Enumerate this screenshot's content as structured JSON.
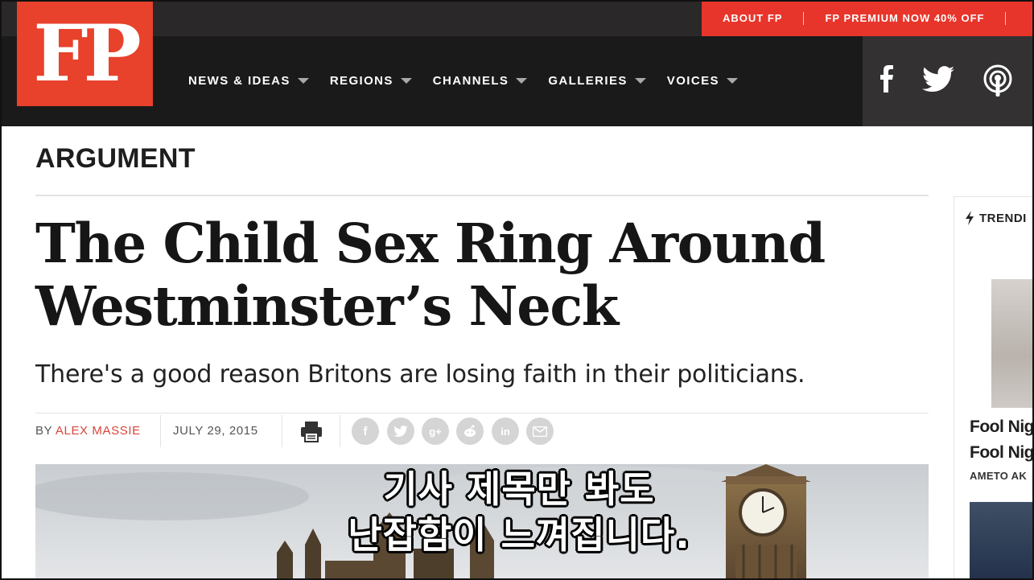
{
  "site": {
    "logo_text": "FP",
    "brand_color": "#e8412c",
    "top_links": [
      "ABOUT FP",
      "FP PREMIUM NOW 40% OFF"
    ],
    "nav": [
      {
        "label": "NEWS & IDEAS"
      },
      {
        "label": "REGIONS"
      },
      {
        "label": "CHANNELS"
      },
      {
        "label": "GALLERIES"
      },
      {
        "label": "VOICES"
      }
    ],
    "social_icons": [
      "facebook-icon",
      "twitter-icon",
      "podcast-icon"
    ]
  },
  "article": {
    "section": "ARGUMENT",
    "headline_line1": "The Child Sex Ring Around",
    "headline_line2": "Westminster’s Neck",
    "dek": "There's a good reason Britons are losing faith in their politicians.",
    "by_label": "BY",
    "author": "ALEX MASSIE",
    "date": "JULY 29, 2015",
    "share_icons": [
      "facebook-icon",
      "twitter-icon",
      "google-plus-icon",
      "reddit-icon",
      "linkedin-icon",
      "email-icon"
    ]
  },
  "rail": {
    "trending_label": "TRENDI",
    "item_title_1": "Fool Nig",
    "item_title_2": "Fool Nig",
    "item_author": "AMETO AK"
  },
  "subtitles": {
    "line1": "기사 제목만 봐도",
    "line2": "난잡함이 느껴집니다."
  }
}
